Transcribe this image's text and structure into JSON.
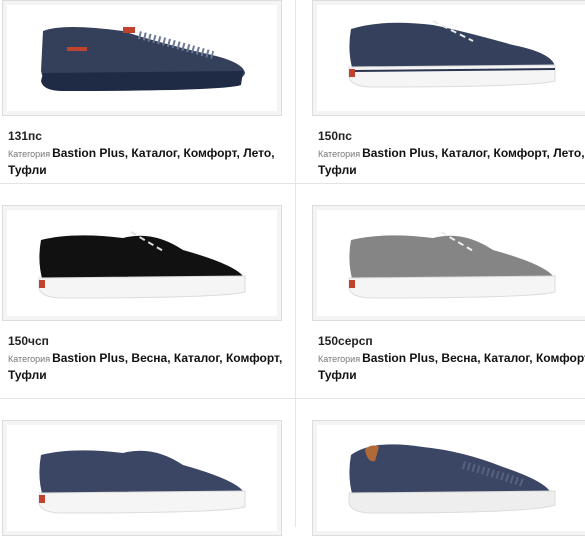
{
  "category_prefix": "Категория",
  "products": [
    {
      "sku": "131пс",
      "categories": "Bastion Plus, Каталог, Комфорт, Лето, Туфли",
      "color": "#34405a",
      "sole": "#1f2a44"
    },
    {
      "sku": "150пс",
      "categories": "Bastion Plus, Каталог, Комфорт, Лето, Туфли",
      "color": "#35415c",
      "sole": "#f5f5f5"
    },
    {
      "sku": "150чсп",
      "categories": "Bastion Plus, Весна, Каталог, Комфорт, Туфли",
      "color": "#111111",
      "sole": "#f5f5f5"
    },
    {
      "sku": "150серсп",
      "categories": "Bastion Plus, Весна, Каталог, Комфорт, Туфли",
      "color": "#858585",
      "sole": "#f5f5f5"
    },
    {
      "sku": "",
      "categories": "",
      "color": "#3a4663",
      "sole": "#f5f5f5"
    },
    {
      "sku": "",
      "categories": "",
      "color": "#3a4663",
      "sole": "#eeeeee"
    }
  ]
}
